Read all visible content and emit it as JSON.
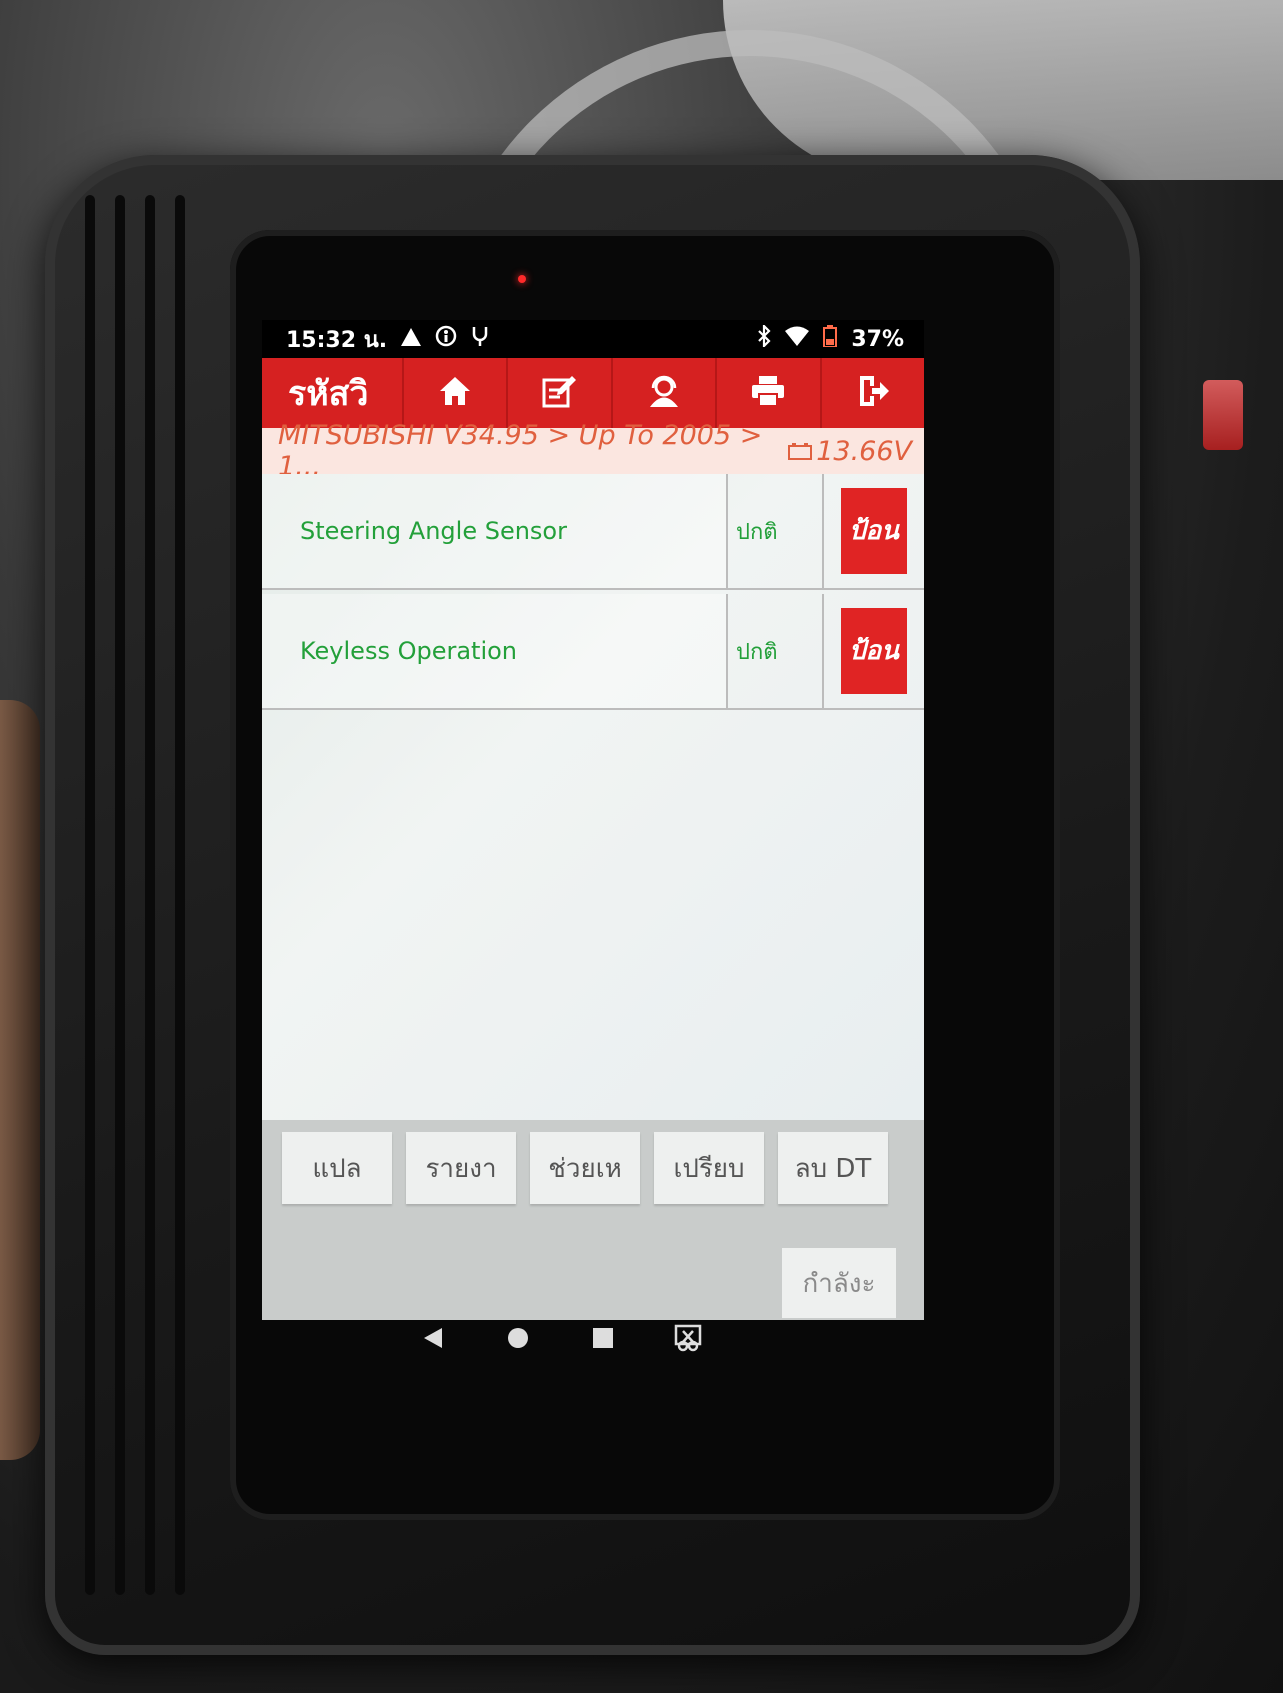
{
  "status_bar": {
    "time": "15:32 น.",
    "battery": "37%"
  },
  "app_bar": {
    "title": "รหัสวิ",
    "icons": [
      "home-icon",
      "edit-icon",
      "support-icon",
      "print-icon",
      "exit-icon"
    ]
  },
  "breadcrumb": {
    "path": "MITSUBISHI V34.95 > Up To 2005 > 1...",
    "voltage": "13.66V"
  },
  "systems": [
    {
      "name": "Steering Angle Sensor",
      "status": "ปกติ",
      "action": "ป้อน"
    },
    {
      "name": "Keyless Operation",
      "status": "ปกติ",
      "action": "ป้อน"
    }
  ],
  "function_buttons": [
    "แปล",
    "รายงา",
    "ช่วยเห",
    "เปรียบ",
    "ลบ DT"
  ],
  "processing_label": "กำลังะ",
  "colors": {
    "accent": "#d62121",
    "ok_text": "#23a03a",
    "breadcrumb_text": "#e0603f"
  }
}
